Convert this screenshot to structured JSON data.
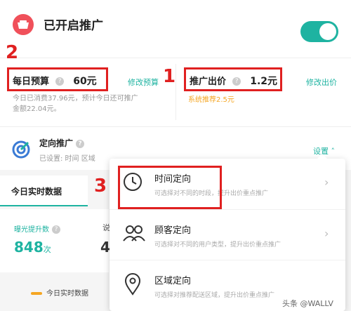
{
  "header": {
    "title": "已开启推广",
    "toggle_on": true,
    "accent": "#1eb3a1"
  },
  "budget": {
    "label": "每日预算",
    "value": "60元",
    "edit_link": "修改预算",
    "note_line1": "今日已消费37.96元，预计今日还可推广",
    "note_line2": "金额22.04元。"
  },
  "bid": {
    "label": "推广出价",
    "value": "1.2元",
    "edit_link": "修改出价",
    "recommend": "系统推荐2.5元"
  },
  "targeting": {
    "title": "定向推广",
    "subtitle": "已设置: 时间 区域",
    "settings_link": "设置"
  },
  "stats": {
    "tab_label": "今日实时数据",
    "metric_label": "曝光提升数",
    "metric_value": "848",
    "metric_unit": "次",
    "partial_label": "说",
    "partial_value": "4",
    "legend_label": "今日实时数据"
  },
  "popup": {
    "items": [
      {
        "title": "时间定向",
        "desc": "可选择对不同的时段，提升出价重点推广",
        "icon": "clock-icon"
      },
      {
        "title": "顾客定向",
        "desc": "可选择对不同的用户类型，提升出价重点推广",
        "icon": "people-icon"
      },
      {
        "title": "区域定向",
        "desc": "可选择对推荐配送区域，提升出价重点推广",
        "icon": "location-pin-icon"
      }
    ]
  },
  "annotations": {
    "num1": "1",
    "num2": "2",
    "num3": "3",
    "color": "#e02020"
  },
  "watermark": "头条 @WALLV"
}
